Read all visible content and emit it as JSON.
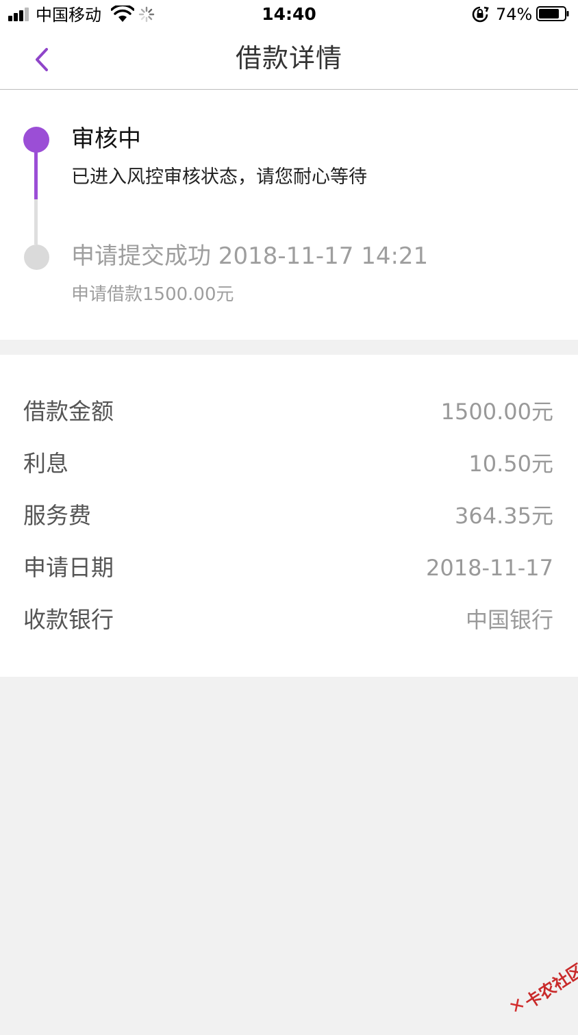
{
  "status_bar": {
    "carrier": "中国移动",
    "time": "14:40",
    "battery_pct": "74%"
  },
  "nav": {
    "title": "借款详情"
  },
  "progress": {
    "steps": [
      {
        "title": "审核中",
        "desc": "已进入风控审核状态，请您耐心等待",
        "active": true
      },
      {
        "title": "申请提交成功 2018-11-17 14:21",
        "desc": "申请借款1500.00元",
        "active": false
      }
    ],
    "accent_color": "#9b4ed6"
  },
  "details": {
    "rows": [
      {
        "label": "借款金额",
        "value": "1500.00元"
      },
      {
        "label": "利息",
        "value": "10.50元"
      },
      {
        "label": "服务费",
        "value": "364.35元"
      },
      {
        "label": "申请日期",
        "value": "2018-11-17"
      },
      {
        "label": "收款银行",
        "value": "中国银行"
      }
    ]
  },
  "watermark": {
    "text": "卡农社区"
  }
}
